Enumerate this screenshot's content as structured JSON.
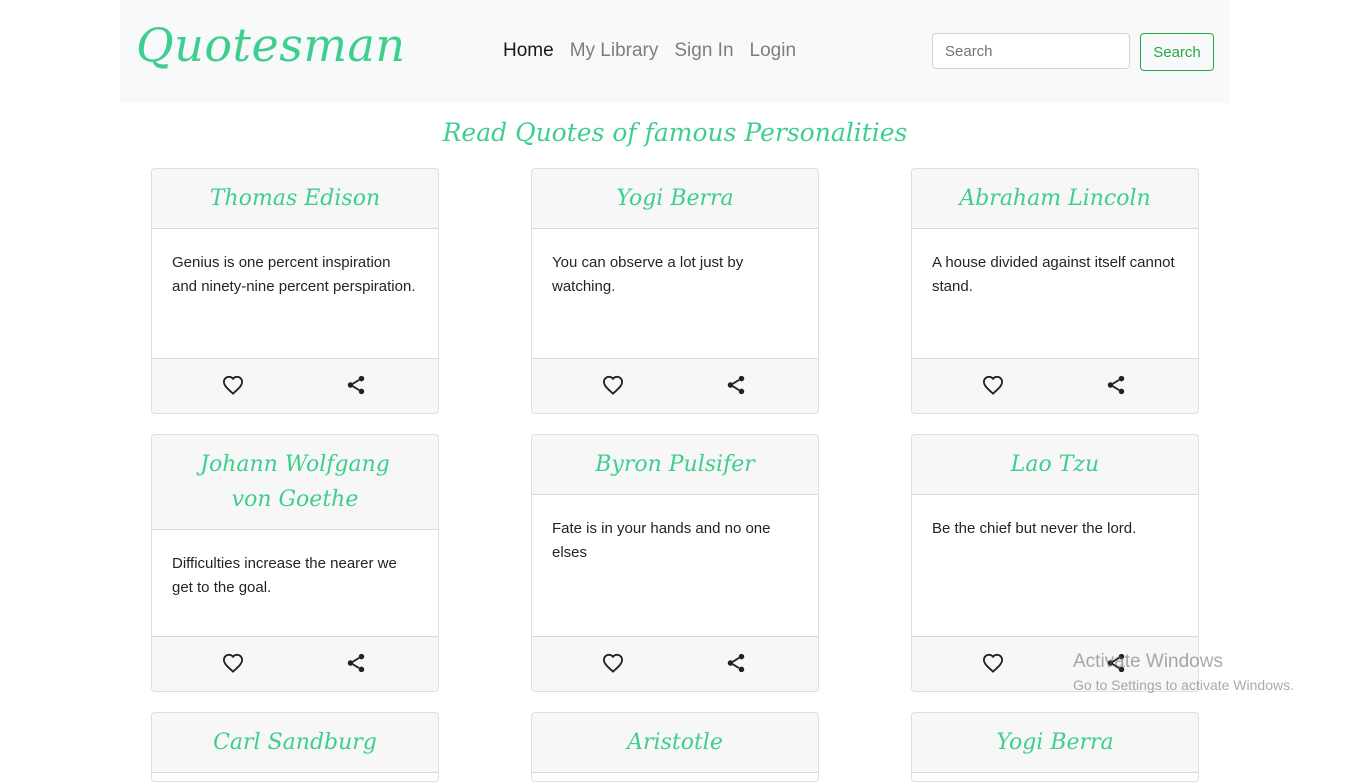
{
  "navbar": {
    "brand": "Quotesman",
    "links": [
      {
        "label": "Home",
        "active": true
      },
      {
        "label": "My Library",
        "active": false
      },
      {
        "label": "Sign In",
        "active": false
      },
      {
        "label": "Login",
        "active": false
      }
    ],
    "search_placeholder": "Search",
    "search_button": "Search"
  },
  "heading": "Read Quotes of famous Personalities",
  "theme": {
    "accent": "#3ecf8e",
    "button_green": "#28a745"
  },
  "cards": [
    {
      "author": "Thomas Edison",
      "quote": "Genius is one percent inspiration and ninety-nine percent perspiration.",
      "icons": [
        "heart-outline-icon",
        "share-icon"
      ]
    },
    {
      "author": "Yogi Berra",
      "quote": "You can observe a lot just by watching.",
      "icons": [
        "heart-outline-icon",
        "share-icon"
      ]
    },
    {
      "author": "Abraham Lincoln",
      "quote": "A house divided against itself cannot stand.",
      "icons": [
        "heart-outline-icon",
        "share-icon"
      ]
    },
    {
      "author": "Johann Wolfgang von Goethe",
      "quote": "Difficulties increase the nearer we get to the goal.",
      "icons": [
        "heart-outline-icon",
        "share-icon"
      ]
    },
    {
      "author": "Byron Pulsifer",
      "quote": "Fate is in your hands and no one elses",
      "icons": [
        "heart-outline-icon",
        "share-icon"
      ]
    },
    {
      "author": "Lao Tzu",
      "quote": "Be the chief but never the lord.",
      "icons": [
        "heart-outline-icon",
        "share-icon"
      ]
    },
    {
      "author": "Carl Sandburg",
      "quote": "",
      "icons": []
    },
    {
      "author": "Aristotle",
      "quote": "",
      "icons": []
    },
    {
      "author": "Yogi Berra",
      "quote": "",
      "icons": []
    }
  ],
  "watermark": {
    "title": "Activate Windows",
    "subtitle": "Go to Settings to activate Windows."
  }
}
